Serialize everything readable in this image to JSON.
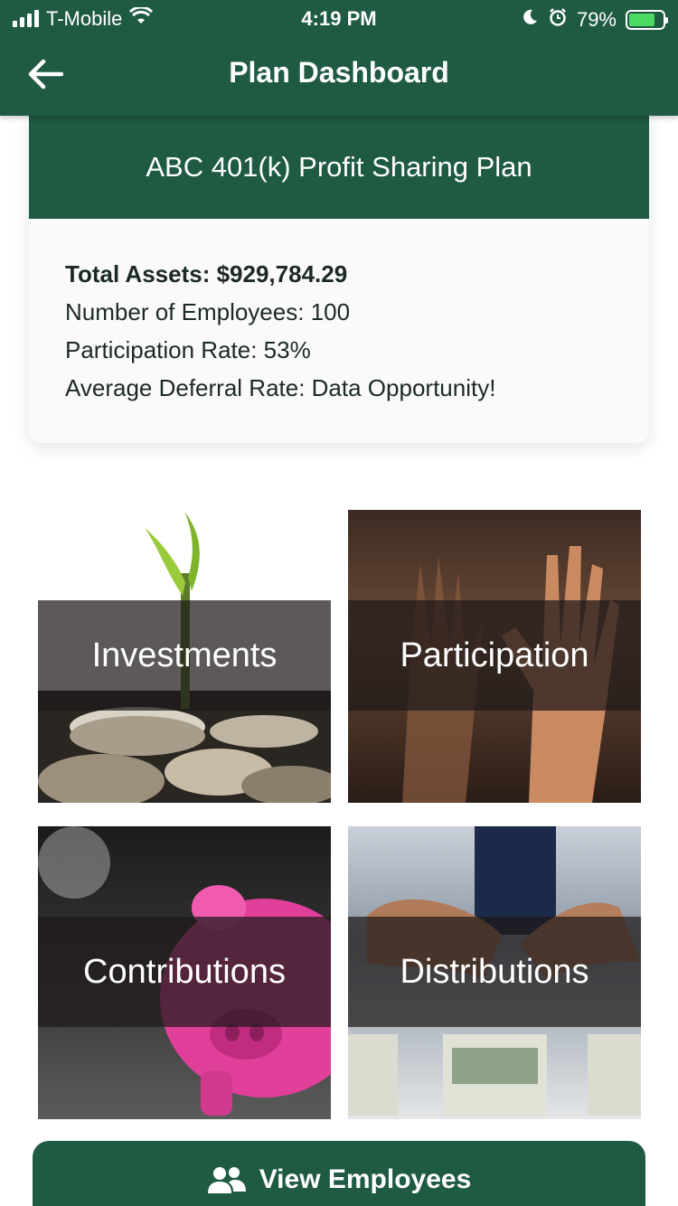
{
  "status_bar": {
    "carrier": "T-Mobile",
    "time": "4:19 PM",
    "battery": "79%",
    "battery_level": 0.79
  },
  "nav": {
    "title": "Plan Dashboard",
    "back_icon": "arrow-left-icon"
  },
  "plan": {
    "name": "ABC 401(k) Profit Sharing Plan",
    "total_assets": "Total Assets: $929,784.29",
    "employees": "Number of Employees: 100",
    "participation": "Participation Rate: 53%",
    "deferral": "Average Deferral Rate: Data Opportunity!"
  },
  "tiles": [
    {
      "label": "Investments"
    },
    {
      "label": "Participation"
    },
    {
      "label": "Contributions"
    },
    {
      "label": "Distributions"
    }
  ],
  "actions": {
    "view_employees": "View Employees",
    "view_employees_icon": "users-icon"
  },
  "colors": {
    "brand_green": "#1f5a43",
    "background": "#ffffff"
  }
}
